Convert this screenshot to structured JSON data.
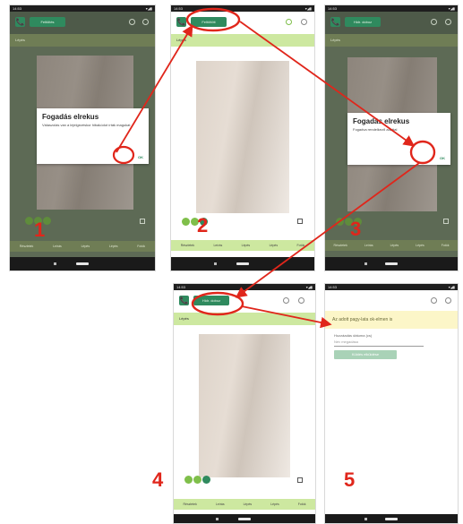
{
  "status_bar": {
    "time": "14:53",
    "icons": "▾◢▮"
  },
  "tab_bar_labels": [
    "Részletek",
    "Leírás",
    "Lépés",
    "Lépés",
    "Fotók"
  ],
  "subtitle": "Lépés",
  "call_button": {
    "label": "📞"
  },
  "steps": [
    "1",
    "2",
    "3",
    "4",
    "5"
  ],
  "screen1": {
    "pill_label": "Feltöltés",
    "dialog_title": "Fogadás elrekus",
    "dialog_text": "Válaszolás van a lejelgezéskor hibakódot írták magukat",
    "dialog_ok": "OK"
  },
  "screen2": {
    "pill_label": "Feltöltött"
  },
  "screen3": {
    "pill_label": "Hidr. doboz",
    "dialog_title": "Fogadás elrekus",
    "dialog_text": "Fogadva rendelkező adattal",
    "dialog_ok": "OK"
  },
  "screen4": {
    "pill_label": "Hidr. doboz"
  },
  "screen5": {
    "banner": "Az adott pagy-lata ok-elmen is",
    "field_label": "Hozzáadás dátuma (cs)",
    "field_value": "Név megadása",
    "button_label": "Küldés elküldése"
  },
  "colors": {
    "accent_green": "#2f8a5e",
    "light_green": "#cde8a0",
    "annotation_red": "#e0261b",
    "banner_yellow": "#fcf6c8"
  }
}
